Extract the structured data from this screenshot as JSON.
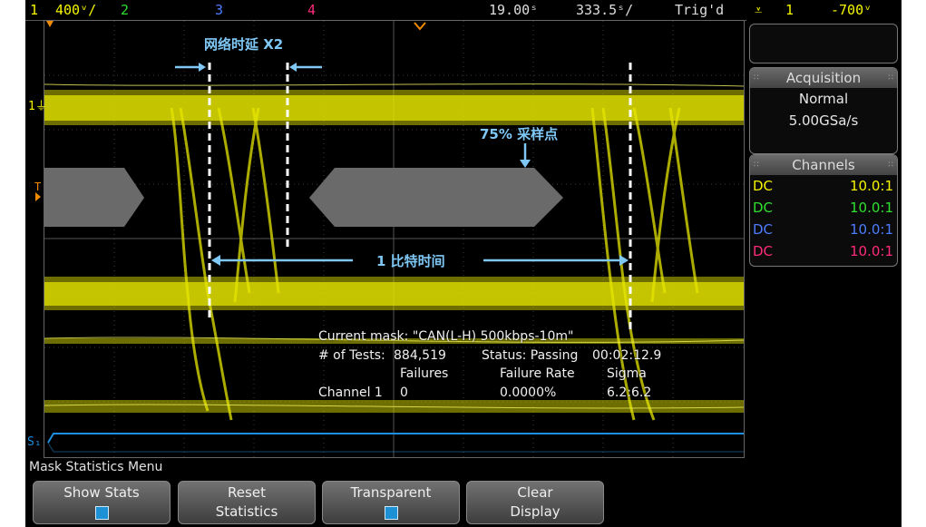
{
  "status_bar": {
    "ch1_num": "1",
    "ch1_scale": "400ᵛ/",
    "ch2_num": "2",
    "ch3_num": "3",
    "ch4_num": "4",
    "timebase_delay": "19.00ˢ",
    "timebase_scale": "333.5ˢ/",
    "trigger_state": "Trig'd",
    "trigger_icon": "rising-edge-icon",
    "trigger_source": "1",
    "trigger_level": "-700ᵛ"
  },
  "screen_markers": {
    "ch1_ground": "1",
    "trigger_marker": "T",
    "serial_marker": "S₁"
  },
  "annotations": {
    "delay_label": "网络时延 X2",
    "sample_label": "75% 采样点",
    "bit_time_label": "1 比特时间"
  },
  "mask_stats": {
    "current_mask": "Current mask: \"CAN(L-H) 500kbps-10m\"",
    "tests_label": "# of Tests:",
    "tests_value": "884,519",
    "status_label": "Status: Passing",
    "elapsed": "00:02:12.9",
    "col_failures": "Failures",
    "col_rate": "Failure Rate",
    "col_sigma": "Sigma",
    "row_channel": "Channel 1",
    "row_failures": "0",
    "row_rate": "0.0000%",
    "row_sigma": "6.2:6.2"
  },
  "acquisition": {
    "title": "Acquisition",
    "mode": "Normal",
    "rate": "5.00GSa/s"
  },
  "channels": {
    "title": "Channels",
    "rows": [
      {
        "coupling": "DC",
        "probe": "10.0:1",
        "color": "#f5f500"
      },
      {
        "coupling": "DC",
        "probe": "10.0:1",
        "color": "#2fe02f"
      },
      {
        "coupling": "DC",
        "probe": "10.0:1",
        "color": "#4d7dff"
      },
      {
        "coupling": "DC",
        "probe": "10.0:1",
        "color": "#ff2b7a"
      }
    ]
  },
  "menu": {
    "title": "Mask Statistics Menu",
    "softkeys": [
      {
        "line1": "Show Stats",
        "line2": ""
      },
      {
        "line1": "Reset",
        "line2": "Statistics"
      },
      {
        "line1": "Transparent",
        "line2": ""
      },
      {
        "line1": "Clear",
        "line2": "Display"
      }
    ]
  },
  "colors": {
    "ch1": "#f5f500",
    "ch2": "#2fe02f",
    "ch3": "#4d7dff",
    "ch4": "#ff2b7a",
    "trace": "#e6e600",
    "mask": "#6a6a6a",
    "annotation": "#7fc8f6",
    "serial": "#1e8fe0"
  }
}
